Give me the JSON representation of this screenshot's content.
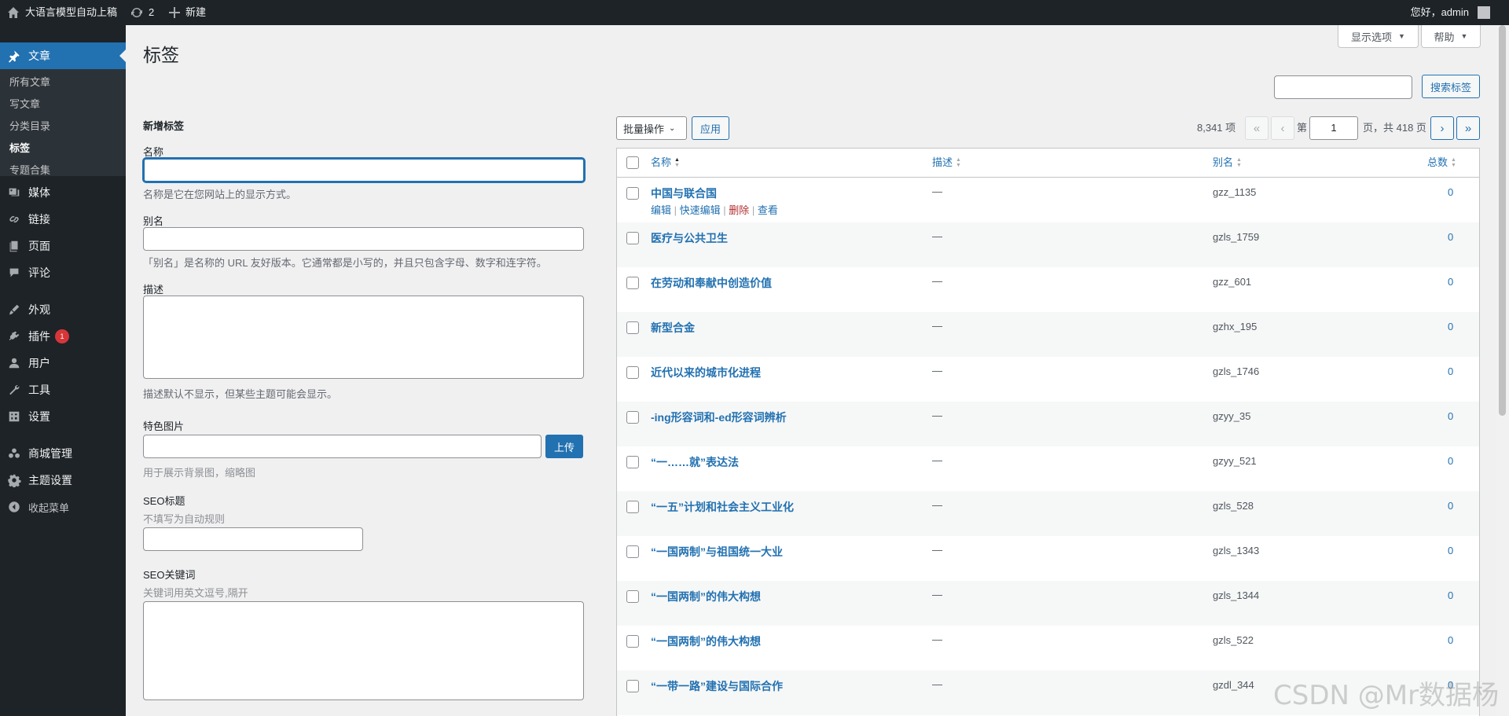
{
  "admin_bar": {
    "site_name": "大语言模型自动上稿",
    "updates_count": "2",
    "new_label": "新建",
    "greeting": "您好，admin"
  },
  "sidebar": {
    "posts": {
      "label": "文章",
      "submenu": [
        "所有文章",
        "写文章",
        "分类目录",
        "标签",
        "专题合集"
      ],
      "current_sub": "标签"
    },
    "items": [
      {
        "label": "媒体",
        "icon": "media-icon"
      },
      {
        "label": "链接",
        "icon": "link-icon"
      },
      {
        "label": "页面",
        "icon": "page-icon"
      },
      {
        "label": "评论",
        "icon": "comment-icon"
      },
      {
        "label": "外观",
        "icon": "appearance-icon"
      },
      {
        "label": "插件",
        "icon": "plugin-icon",
        "badge": "1"
      },
      {
        "label": "用户",
        "icon": "user-icon"
      },
      {
        "label": "工具",
        "icon": "tools-icon"
      },
      {
        "label": "设置",
        "icon": "settings-icon"
      },
      {
        "label": "商城管理",
        "icon": "shop-icon"
      },
      {
        "label": "主题设置",
        "icon": "gear-icon"
      },
      {
        "label": "收起菜单",
        "icon": "collapse-icon"
      }
    ]
  },
  "header": {
    "title": "标签",
    "screen_options": "显示选项",
    "help": "帮助",
    "search_button": "搜索标签"
  },
  "form": {
    "heading": "新增标签",
    "name_label": "名称",
    "name_desc": "名称是它在您网站上的显示方式。",
    "slug_label": "别名",
    "slug_desc": "「别名」是名称的 URL 友好版本。它通常都是小写的，并且只包含字母、数字和连字符。",
    "description_label": "描述",
    "description_desc": "描述默认不显示，但某些主题可能会显示。",
    "image_label": "特色图片",
    "upload_button": "上传",
    "image_desc": "用于展示背景图，缩略图",
    "seo_title_label": "SEO标题",
    "seo_title_desc": "不填写为自动规则",
    "seo_keywords_label": "SEO关键词",
    "seo_keywords_desc": "关键词用英文逗号,隔开"
  },
  "tablenav": {
    "bulk_actions": "批量操作",
    "apply": "应用",
    "item_count": "8,341 项",
    "first": "«",
    "prev": "‹",
    "page_prefix": "第",
    "current_page": "1",
    "page_suffix": "页，共 418 页",
    "next": "›",
    "last": "»"
  },
  "table": {
    "columns": {
      "name": "名称",
      "description": "描述",
      "slug": "别名",
      "count": "总数"
    },
    "row_actions": {
      "edit": "编辑",
      "quick_edit": "快速编辑",
      "delete": "删除",
      "view": "查看"
    },
    "rows": [
      {
        "name": "中国与联合国",
        "desc": "—",
        "slug": "gzz_1135",
        "count": "0"
      },
      {
        "name": "医疗与公共卫生",
        "desc": "—",
        "slug": "gzls_1759",
        "count": "0"
      },
      {
        "name": "在劳动和奉献中创造价值",
        "desc": "—",
        "slug": "gzz_601",
        "count": "0"
      },
      {
        "name": "新型合金",
        "desc": "—",
        "slug": "gzhx_195",
        "count": "0"
      },
      {
        "name": "近代以来的城市化进程",
        "desc": "—",
        "slug": "gzls_1746",
        "count": "0"
      },
      {
        "name": "-ing形容词和-ed形容词辨析",
        "desc": "—",
        "slug": "gzyy_35",
        "count": "0"
      },
      {
        "name": "“一……就”表达法",
        "desc": "—",
        "slug": "gzyy_521",
        "count": "0"
      },
      {
        "name": "“一五”计划和社会主义工业化",
        "desc": "—",
        "slug": "gzls_528",
        "count": "0"
      },
      {
        "name": "“一国两制”与祖国统一大业",
        "desc": "—",
        "slug": "gzls_1343",
        "count": "0"
      },
      {
        "name": "“一国两制”的伟大构想",
        "desc": "—",
        "slug": "gzls_1344",
        "count": "0"
      },
      {
        "name": "“一国两制”的伟大构想",
        "desc": "—",
        "slug": "gzls_522",
        "count": "0"
      },
      {
        "name": "“一带一路”建设与国际合作",
        "desc": "—",
        "slug": "gzdl_344",
        "count": "0"
      }
    ]
  },
  "watermark": "CSDN @Mr数据杨",
  "colors": {
    "accent": "#2271b1",
    "sidebar": "#1d2327",
    "delete": "#b32d2e",
    "badge": "#d63638"
  }
}
